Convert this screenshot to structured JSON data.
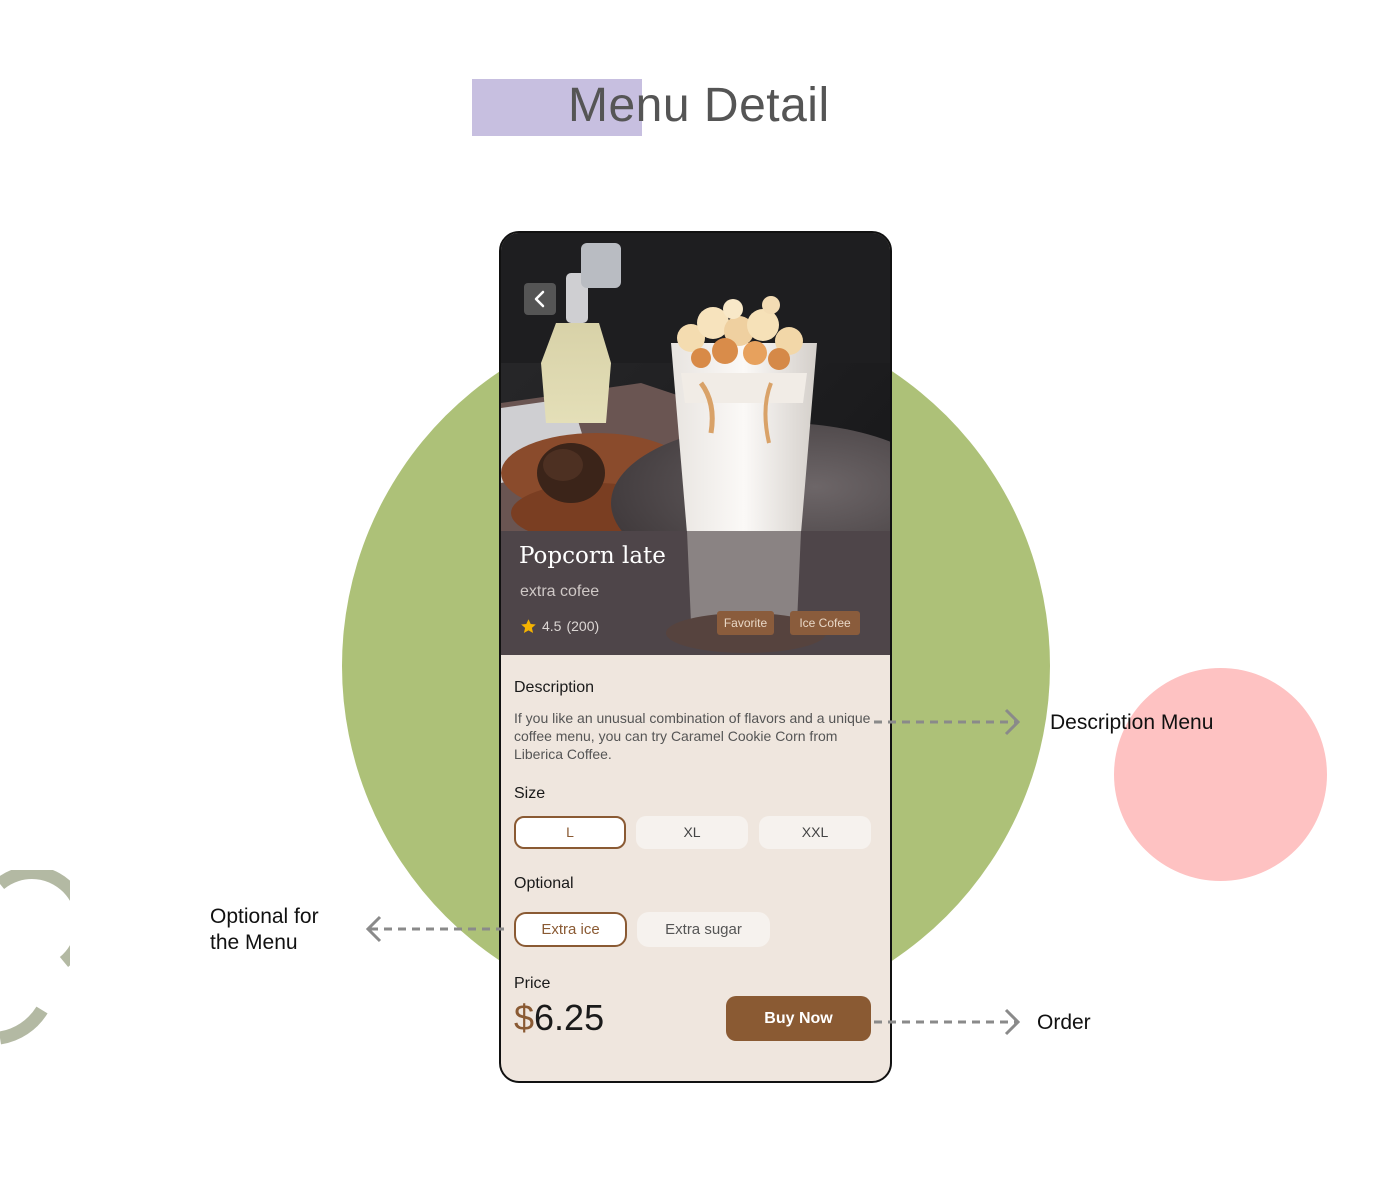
{
  "page_title": "Menu Detail",
  "product": {
    "name": "Popcorn late",
    "subtitle": "extra cofee",
    "rating": "4.5",
    "rating_count": "(200)",
    "tags": [
      "Favorite",
      "Ice Cofee"
    ]
  },
  "description": {
    "label": "Description",
    "text": "If you like an unusual combination of flavors and a unique coffee menu, you can try Caramel Cookie Corn from Liberica Coffee."
  },
  "size": {
    "label": "Size",
    "options": [
      "L",
      "XL",
      "XXL"
    ],
    "selected": "L"
  },
  "optional": {
    "label": "Optional",
    "options": [
      "Extra ice",
      "Extra sugar"
    ],
    "selected": "Extra ice"
  },
  "price": {
    "label": "Price",
    "currency": "$",
    "amount": "6.25"
  },
  "buy_button": "Buy Now",
  "annotations": {
    "description": "Description Menu",
    "optional_line1": "Optional for",
    "optional_line2": "the Menu",
    "order": "Order"
  },
  "colors": {
    "accent_brown": "#8a5a33",
    "green_circle": "#adc178",
    "pink_circle": "#fec2c2",
    "title_highlight": "#c7bfe0",
    "panel_bg": "#efe6de"
  },
  "icons": {
    "back": "chevron-left-icon",
    "rating": "star-icon"
  }
}
